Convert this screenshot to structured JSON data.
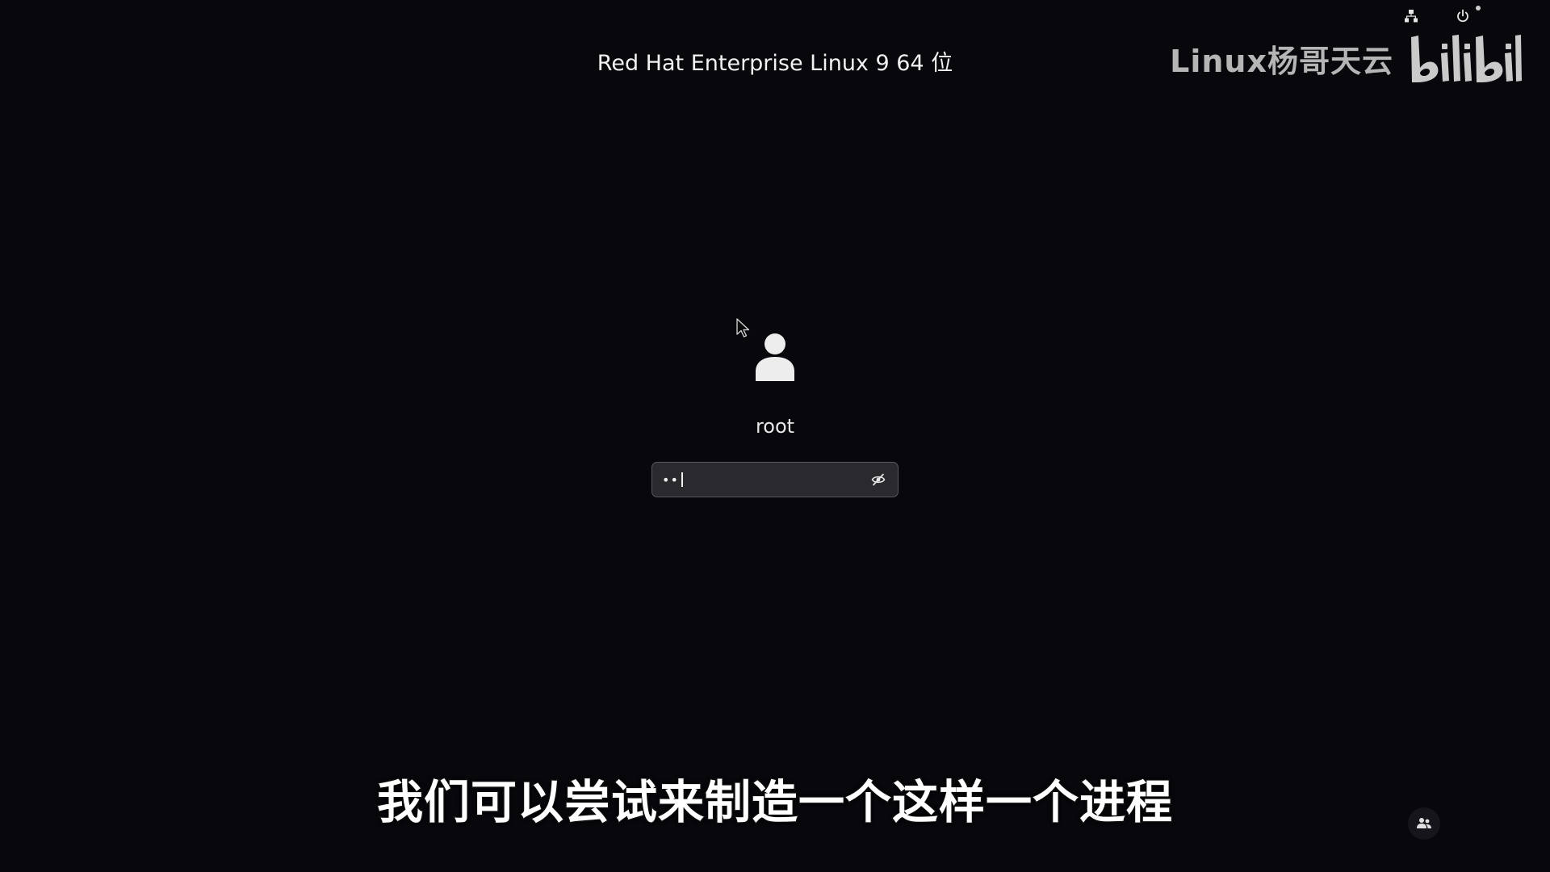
{
  "header": {
    "os_title": "Red Hat Enterprise Linux 9 64 位"
  },
  "tray": {
    "network_icon": "network-icon",
    "power_icon": "power-icon"
  },
  "watermark": {
    "channel_name": "Linux杨哥天云",
    "brand": "bilibili"
  },
  "login": {
    "avatar_icon": "user-avatar-icon",
    "username": "root",
    "password_masked": "••",
    "reveal_icon": "eye-slash-icon"
  },
  "subtitle": {
    "text": "我们可以尝试来制造一个这样一个进程"
  },
  "bottom": {
    "accessibility_icon": "user-switch-icon"
  },
  "colors": {
    "background": "#07070c",
    "text": "#f2f2f2",
    "field_bg": "#2a2a2e",
    "field_border": "#57575c"
  }
}
